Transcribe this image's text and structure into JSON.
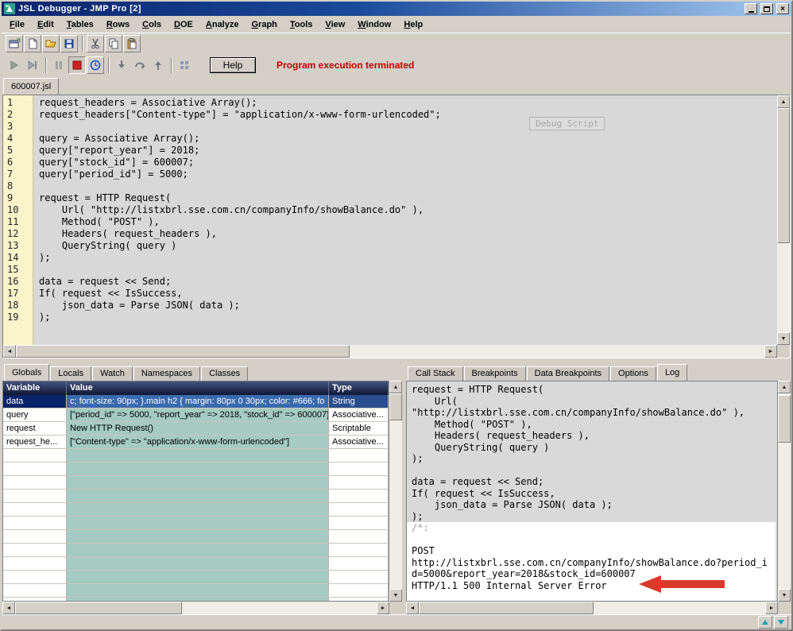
{
  "window": {
    "title": "JSL Debugger - JMP Pro [2]",
    "close_glyph": "×"
  },
  "menu": {
    "items": [
      "File",
      "Edit",
      "Tables",
      "Rows",
      "Cols",
      "DOE",
      "Analyze",
      "Graph",
      "Tools",
      "View",
      "Window",
      "Help"
    ]
  },
  "toolbar_main": {
    "icons": [
      "new-window",
      "new-script",
      "open",
      "save",
      "cut",
      "copy",
      "paste"
    ]
  },
  "toolbar_debug": {
    "icons": [
      "run",
      "run-step",
      "pause",
      "stop",
      "reset",
      "step-into",
      "step-over",
      "step-out",
      "breakpoints"
    ],
    "help_label": "Help",
    "status_text": "Program execution terminated"
  },
  "editor": {
    "tab_label": "600007.jsl",
    "watermark": "Debug Script",
    "lines": [
      "request_headers = Associative Array();",
      "request_headers[\"Content-type\"] = \"application/x-www-form-urlencoded\";",
      "",
      "query = Associative Array();",
      "query[\"report_year\"] = 2018;",
      "query[\"stock_id\"] = 600007;",
      "query[\"period_id\"] = 5000;",
      "",
      "request = HTTP Request(",
      "    Url( \"http://listxbrl.sse.com.cn/companyInfo/showBalance.do\" ),",
      "    Method( \"POST\" ),",
      "    Headers( request_headers ),",
      "    QueryString( query )",
      ");",
      "",
      "data = request << Send;",
      "If( request << IsSuccess,",
      "    json_data = Parse JSON( data );",
      ");"
    ]
  },
  "globals": {
    "tabs": [
      {
        "label": "Globals",
        "active": true
      },
      {
        "label": "Locals"
      },
      {
        "label": "Watch"
      },
      {
        "label": "Namespaces"
      },
      {
        "label": "Classes"
      }
    ],
    "columns": [
      "Variable",
      "Value",
      "Type"
    ],
    "rows": [
      {
        "variable": "data",
        "value": "c; font-size: 90px; }.main h2 {  margin: 80px 0 30px;  color: #666; fo",
        "type": "String",
        "selected": true
      },
      {
        "variable": "query",
        "value": "[\"period_id\" => 5000, \"report_year\" => 2018, \"stock_id\" => 600007]",
        "type": "Associative...",
        "selected": false
      },
      {
        "variable": "request",
        "value": "New HTTP Request()",
        "type": "Scriptable",
        "selected": false
      },
      {
        "variable": "request_he...",
        "value": "[\"Content-type\" => \"application/x-www-form-urlencoded\"]",
        "type": "Associative...",
        "selected": false
      }
    ],
    "empty_rows": 12
  },
  "debug_panel": {
    "tabs": [
      {
        "label": "Call Stack"
      },
      {
        "label": "Breakpoints"
      },
      {
        "label": "Data Breakpoints"
      },
      {
        "label": "Options"
      },
      {
        "label": "Log",
        "active": true
      }
    ],
    "log_gray_lines": [
      "request = HTTP Request(",
      "    Url(",
      "\"http://listxbrl.sse.com.cn/companyInfo/showBalance.do\" ),",
      "    Method( \"POST\" ),",
      "    Headers( request_headers ),",
      "    QueryString( query )",
      ");",
      "",
      "data = request << Send;",
      "If( request << IsSuccess,",
      "    json_data = Parse JSON( data );",
      ");"
    ],
    "log_white_lines": [
      "/*:",
      "",
      "POST",
      "http://listxbrl.sse.com.cn/companyInfo/showBalance.do?period_i",
      "d=5000&report_year=2018&stock_id=600007",
      "HTTP/1.1 500 Internal Server Error"
    ]
  },
  "colors": {
    "titlebar_left": "#0a246a",
    "titlebar_right": "#a6caf0",
    "selection_blue": "#0a246a",
    "value_cell_teal": "#a5cbc3",
    "status_red": "#c00000",
    "arrow_red": "#d93a2b",
    "gutter_yellow": "#fbf4cb"
  }
}
